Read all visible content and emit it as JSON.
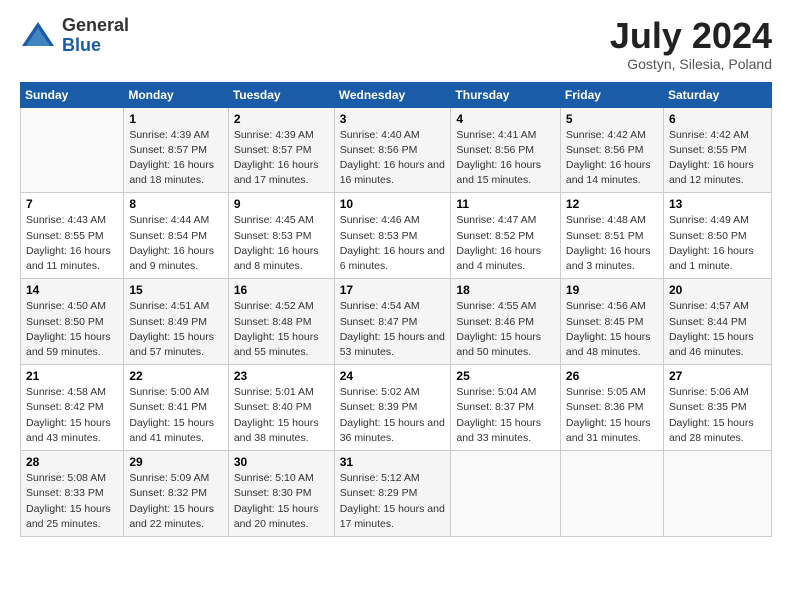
{
  "logo": {
    "general": "General",
    "blue": "Blue"
  },
  "title": "July 2024",
  "subtitle": "Gostyn, Silesia, Poland",
  "headers": [
    "Sunday",
    "Monday",
    "Tuesday",
    "Wednesday",
    "Thursday",
    "Friday",
    "Saturday"
  ],
  "weeks": [
    [
      {
        "day": "",
        "sunrise": "",
        "sunset": "",
        "daylight": ""
      },
      {
        "day": "1",
        "sunrise": "Sunrise: 4:39 AM",
        "sunset": "Sunset: 8:57 PM",
        "daylight": "Daylight: 16 hours and 18 minutes."
      },
      {
        "day": "2",
        "sunrise": "Sunrise: 4:39 AM",
        "sunset": "Sunset: 8:57 PM",
        "daylight": "Daylight: 16 hours and 17 minutes."
      },
      {
        "day": "3",
        "sunrise": "Sunrise: 4:40 AM",
        "sunset": "Sunset: 8:56 PM",
        "daylight": "Daylight: 16 hours and 16 minutes."
      },
      {
        "day": "4",
        "sunrise": "Sunrise: 4:41 AM",
        "sunset": "Sunset: 8:56 PM",
        "daylight": "Daylight: 16 hours and 15 minutes."
      },
      {
        "day": "5",
        "sunrise": "Sunrise: 4:42 AM",
        "sunset": "Sunset: 8:56 PM",
        "daylight": "Daylight: 16 hours and 14 minutes."
      },
      {
        "day": "6",
        "sunrise": "Sunrise: 4:42 AM",
        "sunset": "Sunset: 8:55 PM",
        "daylight": "Daylight: 16 hours and 12 minutes."
      }
    ],
    [
      {
        "day": "7",
        "sunrise": "Sunrise: 4:43 AM",
        "sunset": "Sunset: 8:55 PM",
        "daylight": "Daylight: 16 hours and 11 minutes."
      },
      {
        "day": "8",
        "sunrise": "Sunrise: 4:44 AM",
        "sunset": "Sunset: 8:54 PM",
        "daylight": "Daylight: 16 hours and 9 minutes."
      },
      {
        "day": "9",
        "sunrise": "Sunrise: 4:45 AM",
        "sunset": "Sunset: 8:53 PM",
        "daylight": "Daylight: 16 hours and 8 minutes."
      },
      {
        "day": "10",
        "sunrise": "Sunrise: 4:46 AM",
        "sunset": "Sunset: 8:53 PM",
        "daylight": "Daylight: 16 hours and 6 minutes."
      },
      {
        "day": "11",
        "sunrise": "Sunrise: 4:47 AM",
        "sunset": "Sunset: 8:52 PM",
        "daylight": "Daylight: 16 hours and 4 minutes."
      },
      {
        "day": "12",
        "sunrise": "Sunrise: 4:48 AM",
        "sunset": "Sunset: 8:51 PM",
        "daylight": "Daylight: 16 hours and 3 minutes."
      },
      {
        "day": "13",
        "sunrise": "Sunrise: 4:49 AM",
        "sunset": "Sunset: 8:50 PM",
        "daylight": "Daylight: 16 hours and 1 minute."
      }
    ],
    [
      {
        "day": "14",
        "sunrise": "Sunrise: 4:50 AM",
        "sunset": "Sunset: 8:50 PM",
        "daylight": "Daylight: 15 hours and 59 minutes."
      },
      {
        "day": "15",
        "sunrise": "Sunrise: 4:51 AM",
        "sunset": "Sunset: 8:49 PM",
        "daylight": "Daylight: 15 hours and 57 minutes."
      },
      {
        "day": "16",
        "sunrise": "Sunrise: 4:52 AM",
        "sunset": "Sunset: 8:48 PM",
        "daylight": "Daylight: 15 hours and 55 minutes."
      },
      {
        "day": "17",
        "sunrise": "Sunrise: 4:54 AM",
        "sunset": "Sunset: 8:47 PM",
        "daylight": "Daylight: 15 hours and 53 minutes."
      },
      {
        "day": "18",
        "sunrise": "Sunrise: 4:55 AM",
        "sunset": "Sunset: 8:46 PM",
        "daylight": "Daylight: 15 hours and 50 minutes."
      },
      {
        "day": "19",
        "sunrise": "Sunrise: 4:56 AM",
        "sunset": "Sunset: 8:45 PM",
        "daylight": "Daylight: 15 hours and 48 minutes."
      },
      {
        "day": "20",
        "sunrise": "Sunrise: 4:57 AM",
        "sunset": "Sunset: 8:44 PM",
        "daylight": "Daylight: 15 hours and 46 minutes."
      }
    ],
    [
      {
        "day": "21",
        "sunrise": "Sunrise: 4:58 AM",
        "sunset": "Sunset: 8:42 PM",
        "daylight": "Daylight: 15 hours and 43 minutes."
      },
      {
        "day": "22",
        "sunrise": "Sunrise: 5:00 AM",
        "sunset": "Sunset: 8:41 PM",
        "daylight": "Daylight: 15 hours and 41 minutes."
      },
      {
        "day": "23",
        "sunrise": "Sunrise: 5:01 AM",
        "sunset": "Sunset: 8:40 PM",
        "daylight": "Daylight: 15 hours and 38 minutes."
      },
      {
        "day": "24",
        "sunrise": "Sunrise: 5:02 AM",
        "sunset": "Sunset: 8:39 PM",
        "daylight": "Daylight: 15 hours and 36 minutes."
      },
      {
        "day": "25",
        "sunrise": "Sunrise: 5:04 AM",
        "sunset": "Sunset: 8:37 PM",
        "daylight": "Daylight: 15 hours and 33 minutes."
      },
      {
        "day": "26",
        "sunrise": "Sunrise: 5:05 AM",
        "sunset": "Sunset: 8:36 PM",
        "daylight": "Daylight: 15 hours and 31 minutes."
      },
      {
        "day": "27",
        "sunrise": "Sunrise: 5:06 AM",
        "sunset": "Sunset: 8:35 PM",
        "daylight": "Daylight: 15 hours and 28 minutes."
      }
    ],
    [
      {
        "day": "28",
        "sunrise": "Sunrise: 5:08 AM",
        "sunset": "Sunset: 8:33 PM",
        "daylight": "Daylight: 15 hours and 25 minutes."
      },
      {
        "day": "29",
        "sunrise": "Sunrise: 5:09 AM",
        "sunset": "Sunset: 8:32 PM",
        "daylight": "Daylight: 15 hours and 22 minutes."
      },
      {
        "day": "30",
        "sunrise": "Sunrise: 5:10 AM",
        "sunset": "Sunset: 8:30 PM",
        "daylight": "Daylight: 15 hours and 20 minutes."
      },
      {
        "day": "31",
        "sunrise": "Sunrise: 5:12 AM",
        "sunset": "Sunset: 8:29 PM",
        "daylight": "Daylight: 15 hours and 17 minutes."
      },
      {
        "day": "",
        "sunrise": "",
        "sunset": "",
        "daylight": ""
      },
      {
        "day": "",
        "sunrise": "",
        "sunset": "",
        "daylight": ""
      },
      {
        "day": "",
        "sunrise": "",
        "sunset": "",
        "daylight": ""
      }
    ]
  ]
}
